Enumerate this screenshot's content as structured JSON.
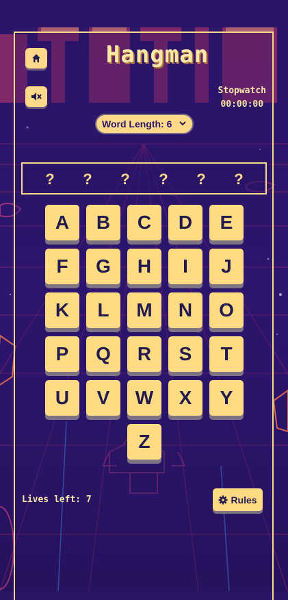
{
  "header": {
    "title": "Hangman",
    "stopwatch_label": "Stopwatch",
    "stopwatch_time": "00:00:00"
  },
  "controls": {
    "home_icon": "home-icon",
    "mute_icon": "speaker-muted-icon",
    "word_length_label": "Word Length: 6"
  },
  "word": {
    "slots": [
      "?",
      "?",
      "?",
      "?",
      "?",
      "?"
    ]
  },
  "keyboard": {
    "keys": [
      "A",
      "B",
      "C",
      "D",
      "E",
      "F",
      "G",
      "H",
      "I",
      "J",
      "K",
      "L",
      "M",
      "N",
      "O",
      "P",
      "Q",
      "R",
      "S",
      "T",
      "U",
      "V",
      "W",
      "X",
      "Y",
      "Z"
    ]
  },
  "footer": {
    "lives_text": "Lives left: 7",
    "rules_label": "Rules",
    "rules_icon": "gear-icon"
  },
  "colors": {
    "background": "#2a1466",
    "accent": "#ffdc84",
    "frame": "#f6d98a",
    "key_text": "#231a4e",
    "neon_pink": "#ff4f8a",
    "neon_blue": "#3aa8ff"
  }
}
